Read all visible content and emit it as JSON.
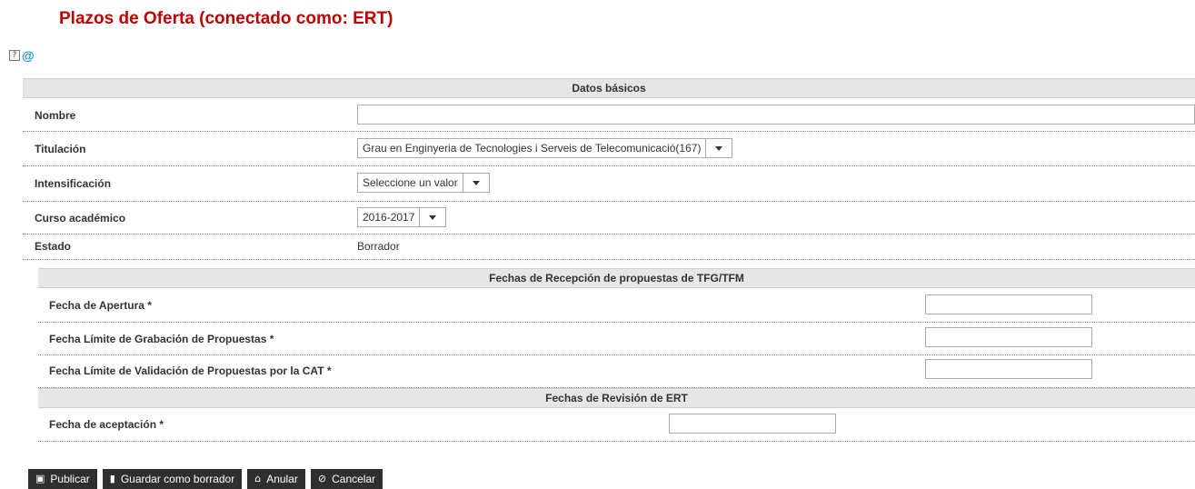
{
  "page": {
    "title": "Plazos de Oferta (conectado como: ERT)"
  },
  "help": {
    "help_glyph": "?",
    "at_glyph": "@"
  },
  "datos_basicos": {
    "header": "Datos básicos",
    "nombre_label": "Nombre",
    "nombre_value": "",
    "titulacion_label": "Titulación",
    "titulacion_value": "Grau en Enginyeria de Tecnologies i Serveis de Telecomunicació(167)",
    "intensificacion_label": "Intensificación",
    "intensificacion_value": "Seleccione un valor",
    "curso_label": "Curso académico",
    "curso_value": "2016-2017",
    "estado_label": "Estado",
    "estado_value": "Borrador"
  },
  "recepcion": {
    "header": "Fechas de Recepción de propuestas de TFG/TFM",
    "apertura_label": "Fecha de Apertura *",
    "apertura_value": "",
    "grabacion_label": "Fecha Límite de Grabación de Propuestas *",
    "grabacion_value": "",
    "validacion_label": "Fecha Límite de Validación de Propuestas por la CAT *",
    "validacion_value": ""
  },
  "revision": {
    "header": "Fechas de Revisión de ERT",
    "aceptacion_label": "Fecha de aceptación *",
    "aceptacion_value": ""
  },
  "actions": {
    "publicar": "Publicar",
    "guardar": "Guardar como borrador",
    "anular": "Anular",
    "cancelar": "Cancelar"
  },
  "icons": {
    "publicar": "save-icon",
    "guardar": "document-icon",
    "anular": "trash-icon",
    "cancelar": "ban-icon"
  }
}
